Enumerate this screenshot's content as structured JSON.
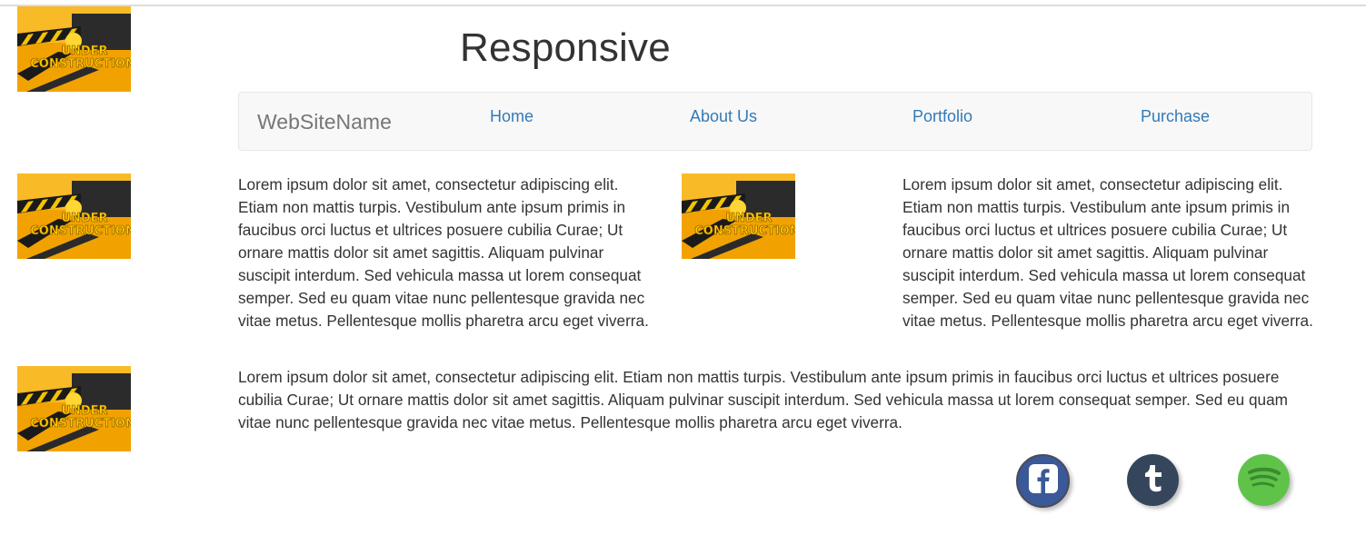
{
  "header": {
    "title": "Responsive",
    "logo_image": "under-construction-image",
    "logo_text_line1": "UNDER",
    "logo_text_line2": "CONSTRUCTION"
  },
  "navbar": {
    "brand": "WebSiteName",
    "links": [
      {
        "label": "Home"
      },
      {
        "label": "About Us"
      },
      {
        "label": "Portfolio"
      },
      {
        "label": "Purchase"
      }
    ]
  },
  "content": {
    "paragraph_left": "Lorem ipsum dolor sit amet, consectetur adipiscing elit. Etiam non mattis turpis. Vestibulum ante ipsum primis in faucibus orci luctus et ultrices posuere cubilia Curae; Ut ornare mattis dolor sit amet sagittis. Aliquam pulvinar suscipit interdum. Sed vehicula massa ut lorem consequat semper. Sed eu quam vitae nunc pellentesque gravida nec vitae metus. Pellentesque mollis pharetra arcu eget viverra.",
    "paragraph_right": "Lorem ipsum dolor sit amet, consectetur adipiscing elit. Etiam non mattis turpis. Vestibulum ante ipsum primis in faucibus orci luctus et ultrices posuere cubilia Curae; Ut ornare mattis dolor sit amet sagittis. Aliquam pulvinar suscipit interdum. Sed vehicula massa ut lorem consequat semper. Sed eu quam vitae nunc pellentesque gravida nec vitae metus. Pellentesque mollis pharetra arcu eget viverra.",
    "paragraph_wide": "Lorem ipsum dolor sit amet, consectetur adipiscing elit. Etiam non mattis turpis. Vestibulum ante ipsum primis in faucibus orci luctus et ultrices posuere cubilia Curae; Ut ornare mattis dolor sit amet sagittis. Aliquam pulvinar suscipit interdum. Sed vehicula massa ut lorem consequat semper. Sed eu quam vitae nunc pellentesque gravida nec vitae metus. Pellentesque mollis pharetra arcu eget viverra."
  },
  "social": [
    {
      "icon": "facebook-icon",
      "color": "#3b5998",
      "border": "#4a4a5a"
    },
    {
      "icon": "tumblr-icon",
      "color": "#35465c"
    },
    {
      "icon": "spotify-icon",
      "color": "#5fc34a"
    }
  ],
  "colors": {
    "link": "#337ab7",
    "brand": "#777777",
    "navbar_bg": "#f8f8f8",
    "navbar_border": "#e7e7e7",
    "text": "#333333"
  }
}
